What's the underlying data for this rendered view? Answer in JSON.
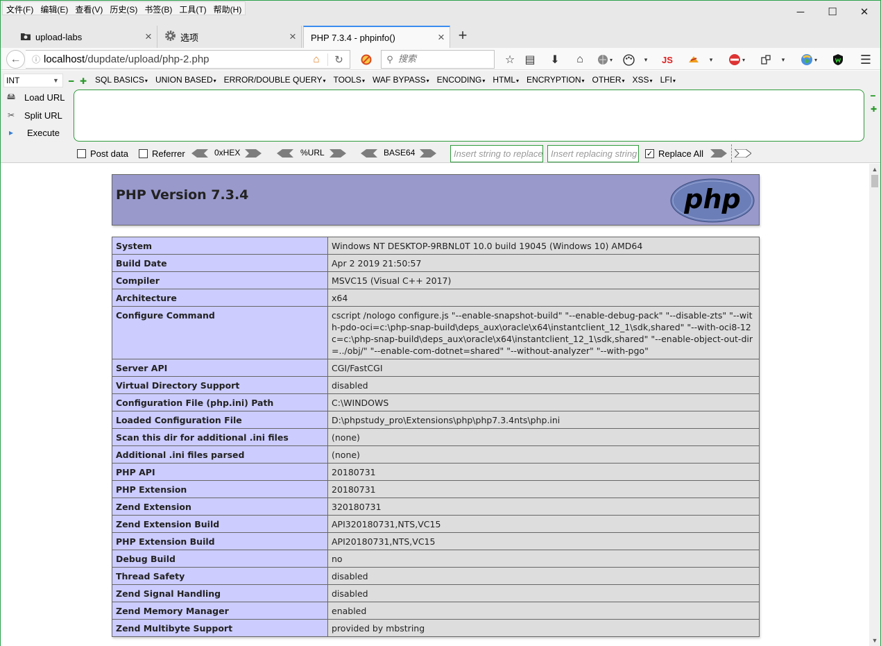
{
  "menu": [
    "文件(F)",
    "编辑(E)",
    "查看(V)",
    "历史(S)",
    "书签(B)",
    "工具(T)",
    "帮助(H)"
  ],
  "window_controls": {
    "minimize": "─",
    "maximize": "☐",
    "close": "✕"
  },
  "tabs": [
    {
      "title": "upload-labs",
      "icon": "folder-icon",
      "active": false
    },
    {
      "title": "选项",
      "icon": "gear-icon",
      "active": false
    },
    {
      "title": "PHP 7.3.4 - phpinfo()",
      "icon": "",
      "active": true
    }
  ],
  "nav": {
    "url_prefix": "localhost",
    "url_path": "/dupdate/upload/php-2.php",
    "search_placeholder": "搜索",
    "js_label": "JS"
  },
  "hackbar": {
    "select_value": "INT",
    "menu": [
      "SQL BASICS",
      "UNION BASED",
      "ERROR/DOUBLE QUERY",
      "TOOLS",
      "WAF BYPASS",
      "ENCODING",
      "HTML",
      "ENCRYPTION",
      "OTHER",
      "XSS",
      "LFI"
    ],
    "load_url": "Load URL",
    "split_url": "Split URL",
    "execute": "Execute",
    "post_data": "Post data",
    "referrer": "Referrer",
    "hex": "0xHEX",
    "url_enc": "%URL",
    "base64": "BASE64",
    "replace_placeholder": "Insert string to replace",
    "replacing_placeholder": "Insert replacing string",
    "replace_all": "Replace All",
    "replace_all_checked": true
  },
  "phpinfo": {
    "title": "PHP Version 7.3.4",
    "logo_text": "php",
    "rows": [
      {
        "k": "System",
        "v": "Windows NT DESKTOP-9RBNL0T 10.0 build 19045 (Windows 10) AMD64"
      },
      {
        "k": "Build Date",
        "v": "Apr 2 2019 21:50:57"
      },
      {
        "k": "Compiler",
        "v": "MSVC15 (Visual C++ 2017)"
      },
      {
        "k": "Architecture",
        "v": "x64"
      },
      {
        "k": "Configure Command",
        "v": "cscript /nologo configure.js \"--enable-snapshot-build\" \"--enable-debug-pack\" \"--disable-zts\" \"--with-pdo-oci=c:\\php-snap-build\\deps_aux\\oracle\\x64\\instantclient_12_1\\sdk,shared\" \"--with-oci8-12c=c:\\php-snap-build\\deps_aux\\oracle\\x64\\instantclient_12_1\\sdk,shared\" \"--enable-object-out-dir=../obj/\" \"--enable-com-dotnet=shared\" \"--without-analyzer\" \"--with-pgo\""
      },
      {
        "k": "Server API",
        "v": "CGI/FastCGI"
      },
      {
        "k": "Virtual Directory Support",
        "v": "disabled"
      },
      {
        "k": "Configuration File (php.ini) Path",
        "v": "C:\\WINDOWS"
      },
      {
        "k": "Loaded Configuration File",
        "v": "D:\\phpstudy_pro\\Extensions\\php\\php7.3.4nts\\php.ini"
      },
      {
        "k": "Scan this dir for additional .ini files",
        "v": "(none)"
      },
      {
        "k": "Additional .ini files parsed",
        "v": "(none)"
      },
      {
        "k": "PHP API",
        "v": "20180731"
      },
      {
        "k": "PHP Extension",
        "v": "20180731"
      },
      {
        "k": "Zend Extension",
        "v": "320180731"
      },
      {
        "k": "Zend Extension Build",
        "v": "API320180731,NTS,VC15"
      },
      {
        "k": "PHP Extension Build",
        "v": "API20180731,NTS,VC15"
      },
      {
        "k": "Debug Build",
        "v": "no"
      },
      {
        "k": "Thread Safety",
        "v": "disabled"
      },
      {
        "k": "Zend Signal Handling",
        "v": "disabled"
      },
      {
        "k": "Zend Memory Manager",
        "v": "enabled"
      },
      {
        "k": "Zend Multibyte Support",
        "v": "provided by mbstring"
      }
    ]
  }
}
